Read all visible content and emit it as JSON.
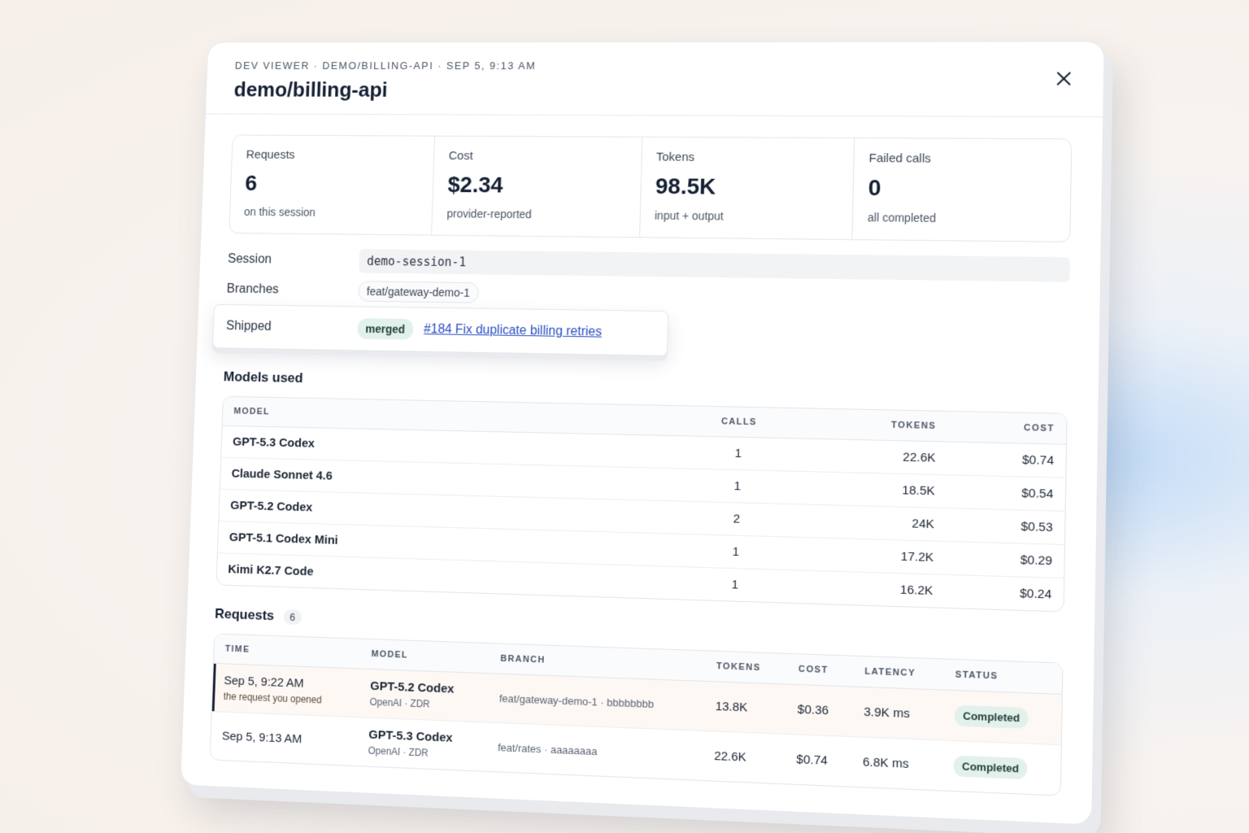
{
  "header": {
    "eyebrow": [
      "DEV VIEWER",
      "·",
      "DEMO/BILLING-API",
      "·",
      "SEP 5, 9:13 AM"
    ],
    "title": "demo/billing-api"
  },
  "stats": [
    {
      "label": "Requests",
      "value": "6",
      "sub": "on this session"
    },
    {
      "label": "Cost",
      "value": "$2.34",
      "sub": "provider-reported"
    },
    {
      "label": "Tokens",
      "value": "98.5K",
      "sub": "input + output"
    },
    {
      "label": "Failed calls",
      "value": "0",
      "sub": "all completed"
    }
  ],
  "meta": {
    "session_label": "Session",
    "session_value": "demo-session-1",
    "branches_label": "Branches",
    "branches_value": "feat/gateway-demo-1",
    "shipped_label": "Shipped",
    "shipped_badge": "merged",
    "shipped_link": "#184 Fix duplicate billing retries"
  },
  "models": {
    "title": "Models used",
    "columns": [
      "MODEL",
      "CALLS",
      "TOKENS",
      "COST"
    ],
    "rows": [
      [
        "GPT-5.3 Codex",
        "1",
        "22.6K",
        "$0.74"
      ],
      [
        "Claude Sonnet 4.6",
        "1",
        "18.5K",
        "$0.54"
      ],
      [
        "GPT-5.2 Codex",
        "2",
        "24K",
        "$0.53"
      ],
      [
        "GPT-5.1 Codex Mini",
        "1",
        "17.2K",
        "$0.29"
      ],
      [
        "Kimi K2.7 Code",
        "1",
        "16.2K",
        "$0.24"
      ]
    ]
  },
  "requests": {
    "title": "Requests",
    "count": "6",
    "columns": [
      "TIME",
      "MODEL",
      "BRANCH",
      "TOKENS",
      "COST",
      "LATENCY",
      "STATUS"
    ],
    "rows": [
      {
        "time": "Sep 5, 9:22 AM",
        "note": "the request you opened",
        "model": "GPT-5.2 Codex",
        "provider": "OpenAI · ZDR",
        "branch": "feat/gateway-demo-1 · bbbbbbbb",
        "tokens": "13.8K",
        "cost": "$0.36",
        "latency": "3.9K ms",
        "status": "Completed"
      },
      {
        "time": "Sep 5, 9:13 AM",
        "note": "",
        "model": "GPT-5.3 Codex",
        "provider": "OpenAI · ZDR",
        "branch": "feat/rates · aaaaaaaa",
        "tokens": "22.6K",
        "cost": "$0.74",
        "latency": "6.8K ms",
        "status": "Completed"
      }
    ]
  }
}
